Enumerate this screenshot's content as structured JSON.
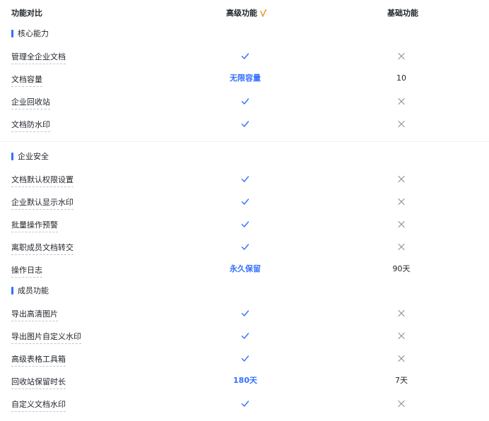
{
  "header": {
    "feature_col": "功能对比",
    "advanced_col": "高级功能",
    "basic_col": "基础功能"
  },
  "colors": {
    "accent": "#3370ff",
    "check": "#3370ff",
    "cross": "#8f959e"
  },
  "sections": [
    {
      "title": "核心能力",
      "rows": [
        {
          "label": "管理全企业文档",
          "advanced": {
            "type": "check"
          },
          "basic": {
            "type": "cross"
          }
        },
        {
          "label": "文档容量",
          "advanced": {
            "type": "text",
            "value": "无限容量"
          },
          "basic": {
            "type": "text",
            "value": "10"
          }
        },
        {
          "label": "企业回收站",
          "advanced": {
            "type": "check"
          },
          "basic": {
            "type": "cross"
          }
        },
        {
          "label": "文档防水印",
          "advanced": {
            "type": "check"
          },
          "basic": {
            "type": "cross"
          }
        }
      ]
    },
    {
      "title": "企业安全",
      "rows": [
        {
          "label": "文档默认权限设置",
          "advanced": {
            "type": "check"
          },
          "basic": {
            "type": "cross"
          }
        },
        {
          "label": "企业默认显示水印",
          "advanced": {
            "type": "check"
          },
          "basic": {
            "type": "cross"
          }
        },
        {
          "label": "批量操作预警",
          "advanced": {
            "type": "check"
          },
          "basic": {
            "type": "cross"
          }
        },
        {
          "label": "离职成员文档转交",
          "advanced": {
            "type": "check"
          },
          "basic": {
            "type": "cross"
          }
        },
        {
          "label": "操作日志",
          "advanced": {
            "type": "text",
            "value": "永久保留"
          },
          "basic": {
            "type": "text",
            "value": "90天"
          }
        }
      ]
    },
    {
      "title": "成员功能",
      "rows": [
        {
          "label": "导出高清图片",
          "advanced": {
            "type": "check"
          },
          "basic": {
            "type": "cross"
          }
        },
        {
          "label": "导出图片自定义水印",
          "advanced": {
            "type": "check"
          },
          "basic": {
            "type": "cross"
          }
        },
        {
          "label": "高级表格工具箱",
          "advanced": {
            "type": "check"
          },
          "basic": {
            "type": "cross"
          }
        },
        {
          "label": "回收站保留时长",
          "advanced": {
            "type": "text",
            "value": "180天"
          },
          "basic": {
            "type": "text",
            "value": "7天"
          }
        },
        {
          "label": "自定义文档水印",
          "advanced": {
            "type": "check"
          },
          "basic": {
            "type": "cross"
          }
        }
      ]
    }
  ]
}
